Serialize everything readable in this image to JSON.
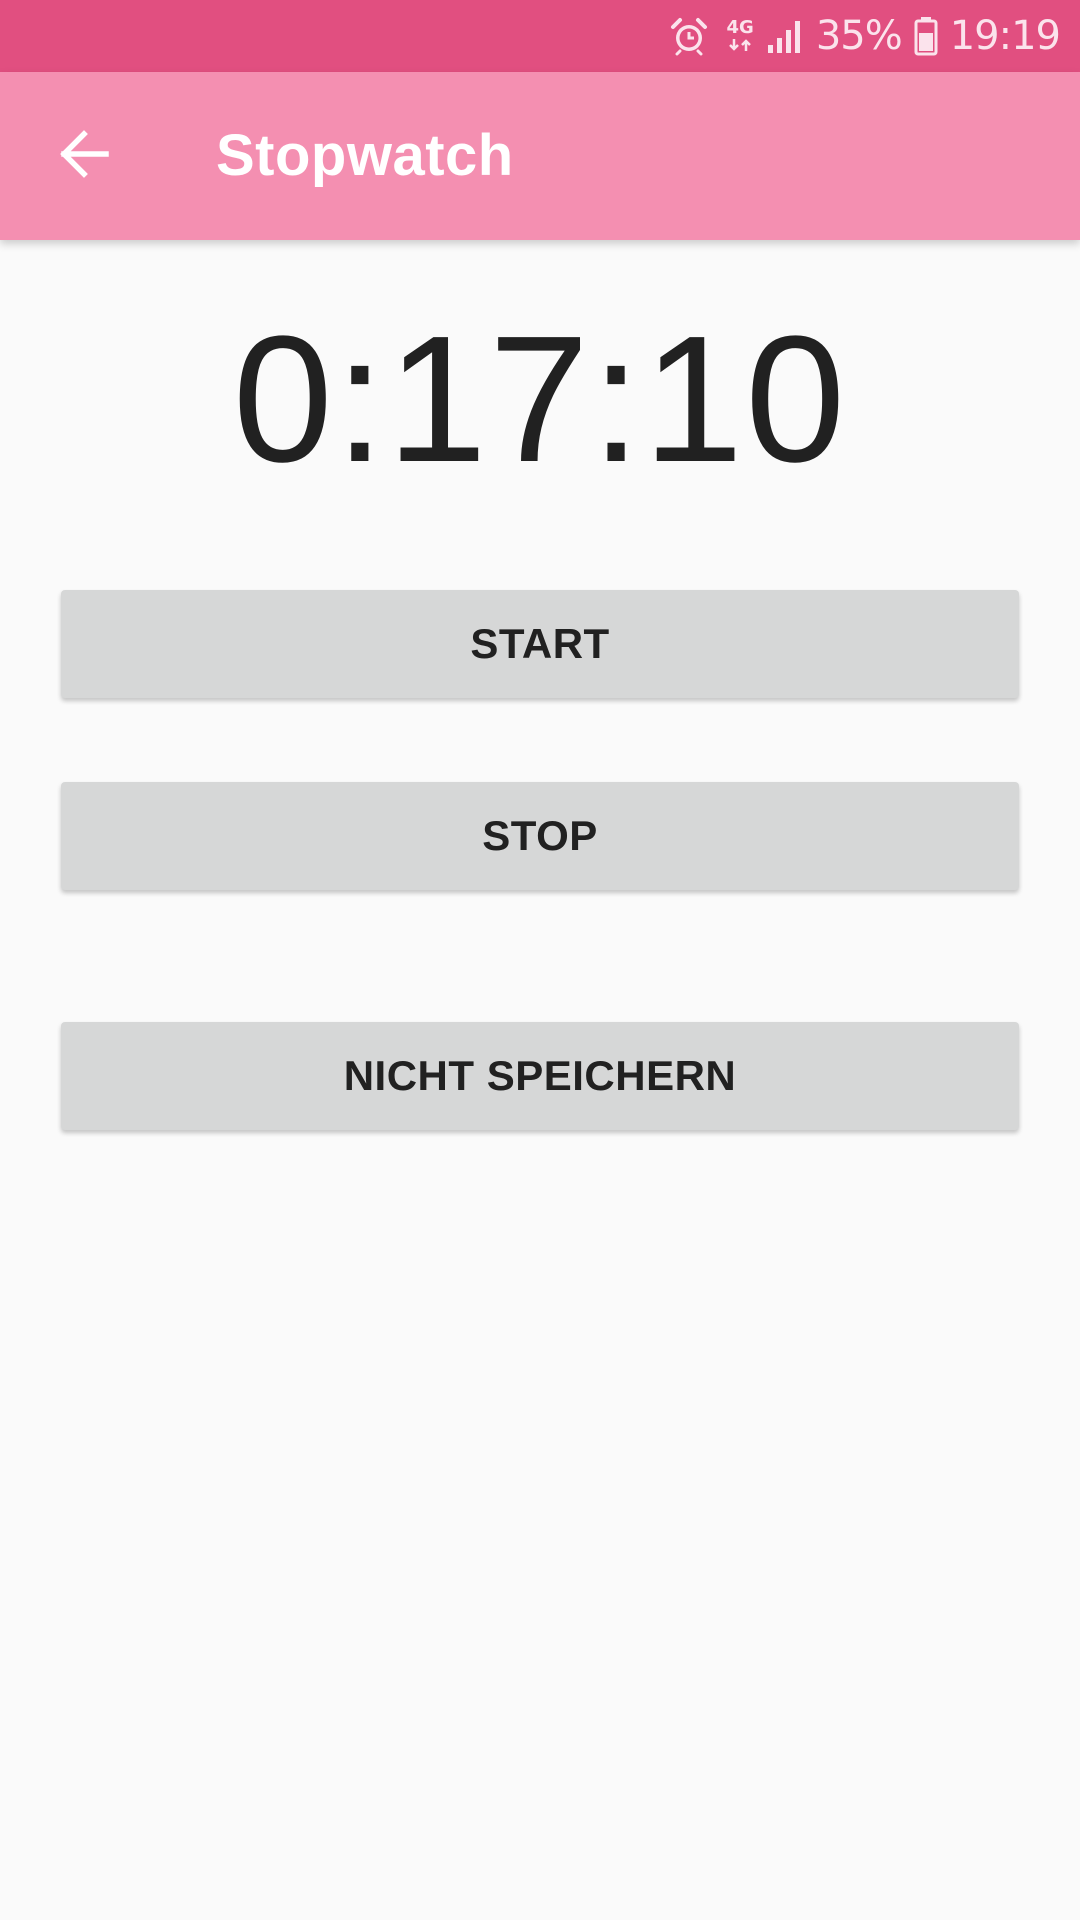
{
  "status_bar": {
    "network_label": "4G",
    "battery_percent": "35%",
    "time": "19:19",
    "icons": [
      "alarm-icon",
      "network-4g-icon",
      "signal-icon",
      "battery-icon"
    ]
  },
  "app_bar": {
    "title": "Stopwatch",
    "back_icon": "arrow-back-icon"
  },
  "timer": {
    "display": "0:17:10"
  },
  "buttons": {
    "start_label": "START",
    "stop_label": "STOP",
    "dont_save_label": "NICHT SPEICHERN"
  },
  "colors": {
    "status_bar": "#e14f80",
    "app_bar": "#f48fb1",
    "background": "#fafafa",
    "button": "#d6d7d7",
    "text": "#212121"
  }
}
